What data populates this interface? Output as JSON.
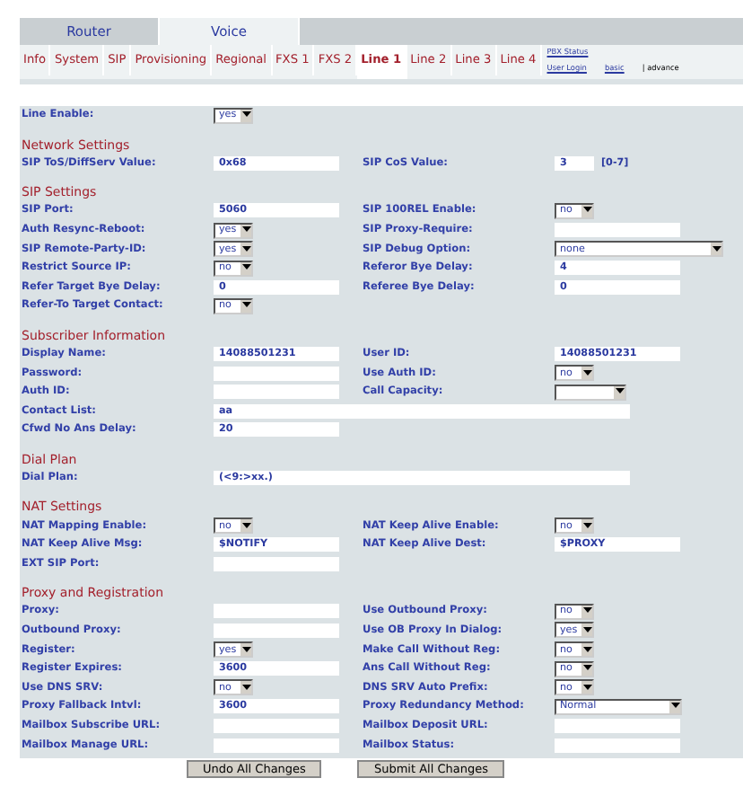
{
  "top_tabs": [
    {
      "label": "Router",
      "selected": false
    },
    {
      "label": "Voice",
      "selected": true
    }
  ],
  "sub_tabs": [
    {
      "label": "Info",
      "selected": false
    },
    {
      "label": "System",
      "selected": false
    },
    {
      "label": "SIP",
      "selected": false
    },
    {
      "label": "Provisioning",
      "selected": false
    },
    {
      "label": "Regional",
      "selected": false
    },
    {
      "label": "FXS 1",
      "selected": false
    },
    {
      "label": "FXS 2",
      "selected": false
    },
    {
      "label": "Line 1",
      "selected": true
    },
    {
      "label": "Line 2",
      "selected": false
    },
    {
      "label": "Line 3",
      "selected": false
    },
    {
      "label": "Line 4",
      "selected": false
    }
  ],
  "pbx_status_link": "PBX Status",
  "user_login_link": "User Login",
  "basic_link": "basic",
  "advanced_label": "| advance",
  "line_enable": {
    "label": "Line Enable:",
    "kind": "select",
    "value": "yes"
  },
  "sections": [
    {
      "title": "Network Settings",
      "rows": [
        [
          {
            "label": "SIP ToS/DiffServ Value:",
            "kind": "text",
            "value": "0x68"
          },
          {
            "label": "SIP CoS Value:",
            "kind": "short_text",
            "value": "3",
            "note": "[0-7]"
          }
        ]
      ]
    },
    {
      "title": "SIP Settings",
      "rows": [
        [
          {
            "label": "SIP Port:",
            "kind": "text",
            "value": "5060"
          },
          {
            "label": "SIP 100REL Enable:",
            "kind": "select",
            "value": "no"
          }
        ],
        [
          {
            "label": "Auth Resync-Reboot:",
            "kind": "select",
            "value": "yes"
          },
          {
            "label": "SIP Proxy-Require:",
            "kind": "text"
          }
        ],
        [
          {
            "label": "SIP Remote-Party-ID:",
            "kind": "select",
            "value": "yes"
          },
          {
            "label": "SIP Debug Option:",
            "kind": "long_select",
            "value": "none"
          }
        ],
        [
          {
            "label": "Restrict Source IP:",
            "kind": "select",
            "value": "no"
          },
          {
            "label": "Referor Bye Delay:",
            "kind": "text",
            "value": "4"
          }
        ],
        [
          {
            "label": "Refer Target Bye Delay:",
            "kind": "text",
            "value": "0"
          },
          {
            "label": "Referee Bye Delay:",
            "kind": "text",
            "value": "0"
          }
        ],
        [
          {
            "label": "Refer-To Target Contact:",
            "kind": "select",
            "value": "no"
          }
        ]
      ]
    },
    {
      "title": "Subscriber Information",
      "rows": [
        [
          {
            "label": "Display Name:",
            "kind": "text",
            "value": "14088501231"
          },
          {
            "label": "User ID:",
            "kind": "text",
            "value": "14088501231"
          }
        ],
        [
          {
            "label": "Password:",
            "kind": "text"
          },
          {
            "label": "Use Auth ID:",
            "kind": "select",
            "value": "no"
          }
        ],
        [
          {
            "label": "Auth ID:",
            "kind": "text"
          },
          {
            "label": "Call Capacity:",
            "kind": "mid_select"
          }
        ],
        [
          {
            "label": "Contact List:",
            "kind": "long_text",
            "value": "aa"
          }
        ],
        [
          {
            "label": "Cfwd No Ans Delay:",
            "kind": "text",
            "value": "20"
          }
        ]
      ]
    },
    {
      "title": "Dial Plan",
      "rows": [
        [
          {
            "label": "Dial Plan:",
            "kind": "long_text",
            "value": "(<9:>xx.)"
          }
        ]
      ]
    },
    {
      "title": "NAT Settings",
      "rows": [
        [
          {
            "label": "NAT Mapping Enable:",
            "kind": "select",
            "value": "no"
          },
          {
            "label": "NAT Keep Alive Enable:",
            "kind": "select",
            "value": "no"
          }
        ],
        [
          {
            "label": "NAT Keep Alive Msg:",
            "kind": "text",
            "value": "$NOTIFY"
          },
          {
            "label": "NAT Keep Alive Dest:",
            "kind": "text",
            "value": "$PROXY"
          }
        ],
        [
          {
            "label": "EXT SIP Port:",
            "kind": "text"
          }
        ]
      ]
    },
    {
      "title": "Proxy and Registration",
      "rows": [
        [
          {
            "label": "Proxy:",
            "kind": "text"
          },
          {
            "label": "Use Outbound Proxy:",
            "kind": "select",
            "value": "no"
          }
        ],
        [
          {
            "label": "Outbound Proxy:",
            "kind": "text"
          },
          {
            "label": "Use OB Proxy In Dialog:",
            "kind": "select",
            "value": "yes"
          }
        ],
        [
          {
            "label": "Register:",
            "kind": "select",
            "value": "yes"
          },
          {
            "label": "Make Call Without Reg:",
            "kind": "select",
            "value": "no"
          }
        ],
        [
          {
            "label": "Register Expires:",
            "kind": "text",
            "value": "3600"
          },
          {
            "label": "Ans Call Without Reg:",
            "kind": "select",
            "value": "no"
          }
        ],
        [
          {
            "label": "Use DNS SRV:",
            "kind": "select",
            "value": "no"
          },
          {
            "label": "DNS SRV Auto Prefix:",
            "kind": "select",
            "value": "no"
          }
        ],
        [
          {
            "label": "Proxy Fallback Intvl:",
            "kind": "text",
            "value": "3600"
          },
          {
            "label": "Proxy Redundancy Method:",
            "kind": "mid_long_select",
            "value": "Normal"
          }
        ],
        [
          {
            "label": "Mailbox Subscribe URL:",
            "kind": "text"
          },
          {
            "label": "Mailbox Deposit URL:",
            "kind": "text"
          }
        ],
        [
          {
            "label": "Mailbox Manage URL:",
            "kind": "text"
          },
          {
            "label": "Mailbox Status:",
            "kind": "text"
          }
        ]
      ]
    }
  ],
  "buttons": [
    "Undo All Changes",
    "Submit All Changes"
  ]
}
